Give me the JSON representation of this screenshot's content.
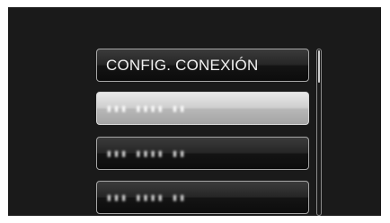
{
  "menu": {
    "items": [
      {
        "label": "CONFIG. CONEXIÓN",
        "state": "default"
      },
      {
        "label": "▮▮▮ ▮▮▮▮ ▮▮",
        "state": "selected"
      },
      {
        "label": "▮▮▮ ▮▮▮▮ ▮▮",
        "state": "default"
      },
      {
        "label": "▮▮▮ ▮▮▮▮ ▮▮",
        "state": "default"
      }
    ]
  },
  "colors": {
    "screen_background": "#1a1a1a",
    "button_border": "#a6a6a6",
    "selected_highlight": "#cfcfcf",
    "text": "#f2f2f2"
  }
}
